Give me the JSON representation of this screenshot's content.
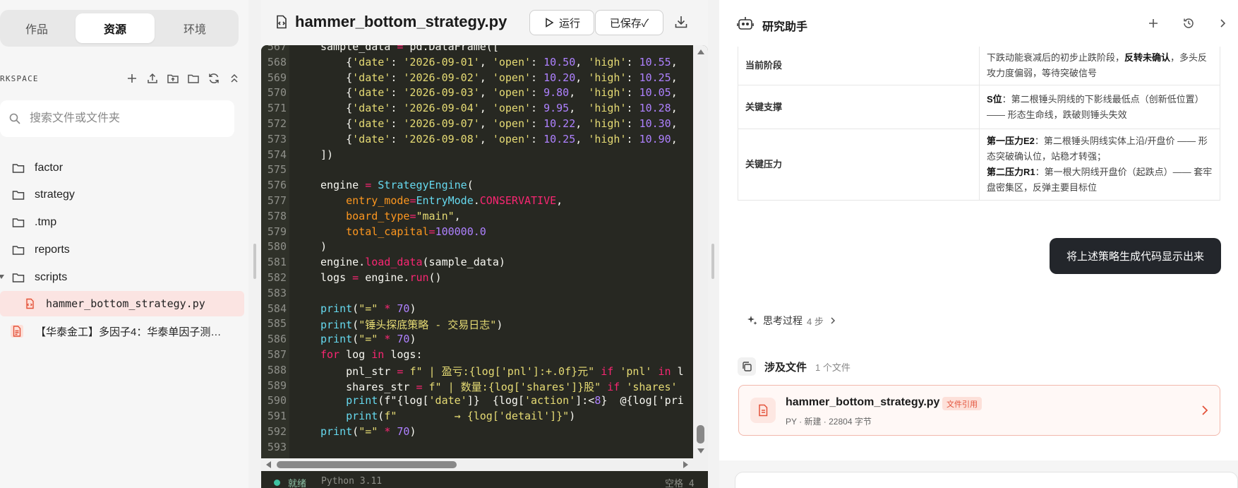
{
  "left": {
    "tabs": [
      "作品",
      "资源",
      "环境"
    ],
    "active_tab": "资源",
    "workspace_label": "RKSPACE",
    "search_placeholder": "搜索文件或文件夹",
    "tree": [
      {
        "label": "factor",
        "icon": "folder-icon"
      },
      {
        "label": "strategy",
        "icon": "folder-icon"
      },
      {
        "label": ".tmp",
        "icon": "folder-icon"
      },
      {
        "label": "reports",
        "icon": "folder-icon"
      },
      {
        "label": "scripts",
        "icon": "folder-icon"
      },
      {
        "label": "hammer_bottom_strategy.py",
        "icon": "python-file-icon"
      },
      {
        "label": "【华泰金工】多因子4：华泰单因子测…",
        "icon": "pdf-file-icon"
      }
    ]
  },
  "editor": {
    "title": "hammer_bottom_strategy.py",
    "run_label": "运行",
    "save_label": "已保存✓",
    "status": {
      "state": "就绪",
      "lang": "Python 3.11",
      "indent": "空格 4"
    }
  },
  "code": {
    "lines": [
      {
        "n": "567",
        "t": "sample_data = pd.DataFrame(["
      },
      {
        "n": "568",
        "t": "    {'date': '2026-09-01', 'open': 10.50, 'high': 10.55,"
      },
      {
        "n": "569",
        "t": "    {'date': '2026-09-02', 'open': 10.20, 'high': 10.25,"
      },
      {
        "n": "570",
        "t": "    {'date': '2026-09-03', 'open': 9.80,  'high': 10.05,"
      },
      {
        "n": "571",
        "t": "    {'date': '2026-09-04', 'open': 9.95,  'high': 10.28,"
      },
      {
        "n": "572",
        "t": "    {'date': '2026-09-07', 'open': 10.22, 'high': 10.30,"
      },
      {
        "n": "573",
        "t": "    {'date': '2026-09-08', 'open': 10.25, 'high': 10.90,"
      },
      {
        "n": "574",
        "t": "])"
      },
      {
        "n": "575",
        "t": ""
      },
      {
        "n": "576",
        "t": "engine = StrategyEngine("
      },
      {
        "n": "577",
        "t": "    entry_mode=EntryMode.CONSERVATIVE,"
      },
      {
        "n": "578",
        "t": "    board_type=\"main\","
      },
      {
        "n": "579",
        "t": "    total_capital=100000.0"
      },
      {
        "n": "580",
        "t": ")"
      },
      {
        "n": "581",
        "t": "engine.load_data(sample_data)"
      },
      {
        "n": "582",
        "t": "logs = engine.run()"
      },
      {
        "n": "583",
        "t": ""
      },
      {
        "n": "584",
        "t": "print(\"=\" * 70)"
      },
      {
        "n": "585",
        "t": "print(\"锤头探底策略 - 交易日志\")"
      },
      {
        "n": "586",
        "t": "print(\"=\" * 70)"
      },
      {
        "n": "587",
        "t": "for log in logs:"
      },
      {
        "n": "588",
        "t": "    pnl_str = f\" | 盈亏:{log['pnl']:+.0f}元\" if 'pnl' in l"
      },
      {
        "n": "589",
        "t": "    shares_str = f\" | 数量:{log['shares']}股\" if 'shares'"
      },
      {
        "n": "590",
        "t": "    print(f\"{log['date']}  {log['action']:<8}  @{log['pri"
      },
      {
        "n": "591",
        "t": "    print(f\"         → {log['detail']}\")"
      },
      {
        "n": "592",
        "t": "print(\"=\" * 70)"
      },
      {
        "n": "593",
        "t": ""
      }
    ]
  },
  "assistant": {
    "title": "研究助手",
    "table": [
      {
        "key": "当前阶段",
        "value": "下跌动能衰减后的初步止跌阶段，<b>反转未确认</b>，多头反攻力度偏弱，等待突破信号"
      },
      {
        "key": "关键支撑",
        "value": "<b>S位</b>：第二根锤头阴线的下影线最低点（创新低位置）—— 形态生命线，跌破则锤头失效"
      },
      {
        "key": "关键压力",
        "value": "<b>第一压力E2</b>：第二根锤头阴线实体上沿/开盘价 —— 形态突破确认位，站稳才转强；<br><b>第二压力R1</b>：第一根大阴线开盘价（起跌点）—— 套牢盘密集区，反弹主要目标位"
      }
    ],
    "user_message": "将上述策略生成代码显示出来",
    "thinking": {
      "label": "思考过程",
      "steps": "4 步"
    },
    "files_section": {
      "label": "涉及文件",
      "count": "1 个文件"
    },
    "file": {
      "name": "hammer_bottom_strategy.py",
      "badge": "文件引用",
      "meta": "PY · 新建 · 22804 字节"
    }
  },
  "colors": {
    "accent": "#e3523a",
    "editor_bg": "#272822",
    "bubble_bg": "#23262b"
  }
}
